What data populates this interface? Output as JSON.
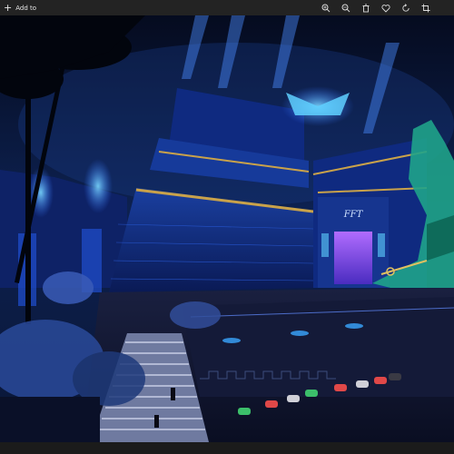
{
  "toolbar": {
    "add_to_label": "Add to",
    "add_icon": "plus-icon",
    "icons": [
      "zoom-in-icon",
      "zoom-out-icon",
      "delete-icon",
      "favorite-heart-icon",
      "rotate-icon",
      "crop-icon"
    ]
  },
  "photo": {
    "subject": "night-scene-egyptian-themed-casino-building",
    "sign_text": "FFT"
  },
  "colors": {
    "toolbar_bg": "#232323",
    "sky": "#0a1a3a",
    "accent_blue": "#2f6bff",
    "neon": "#5fd0ff",
    "gold": "#c9a24a",
    "statue": "#1fa38a"
  }
}
